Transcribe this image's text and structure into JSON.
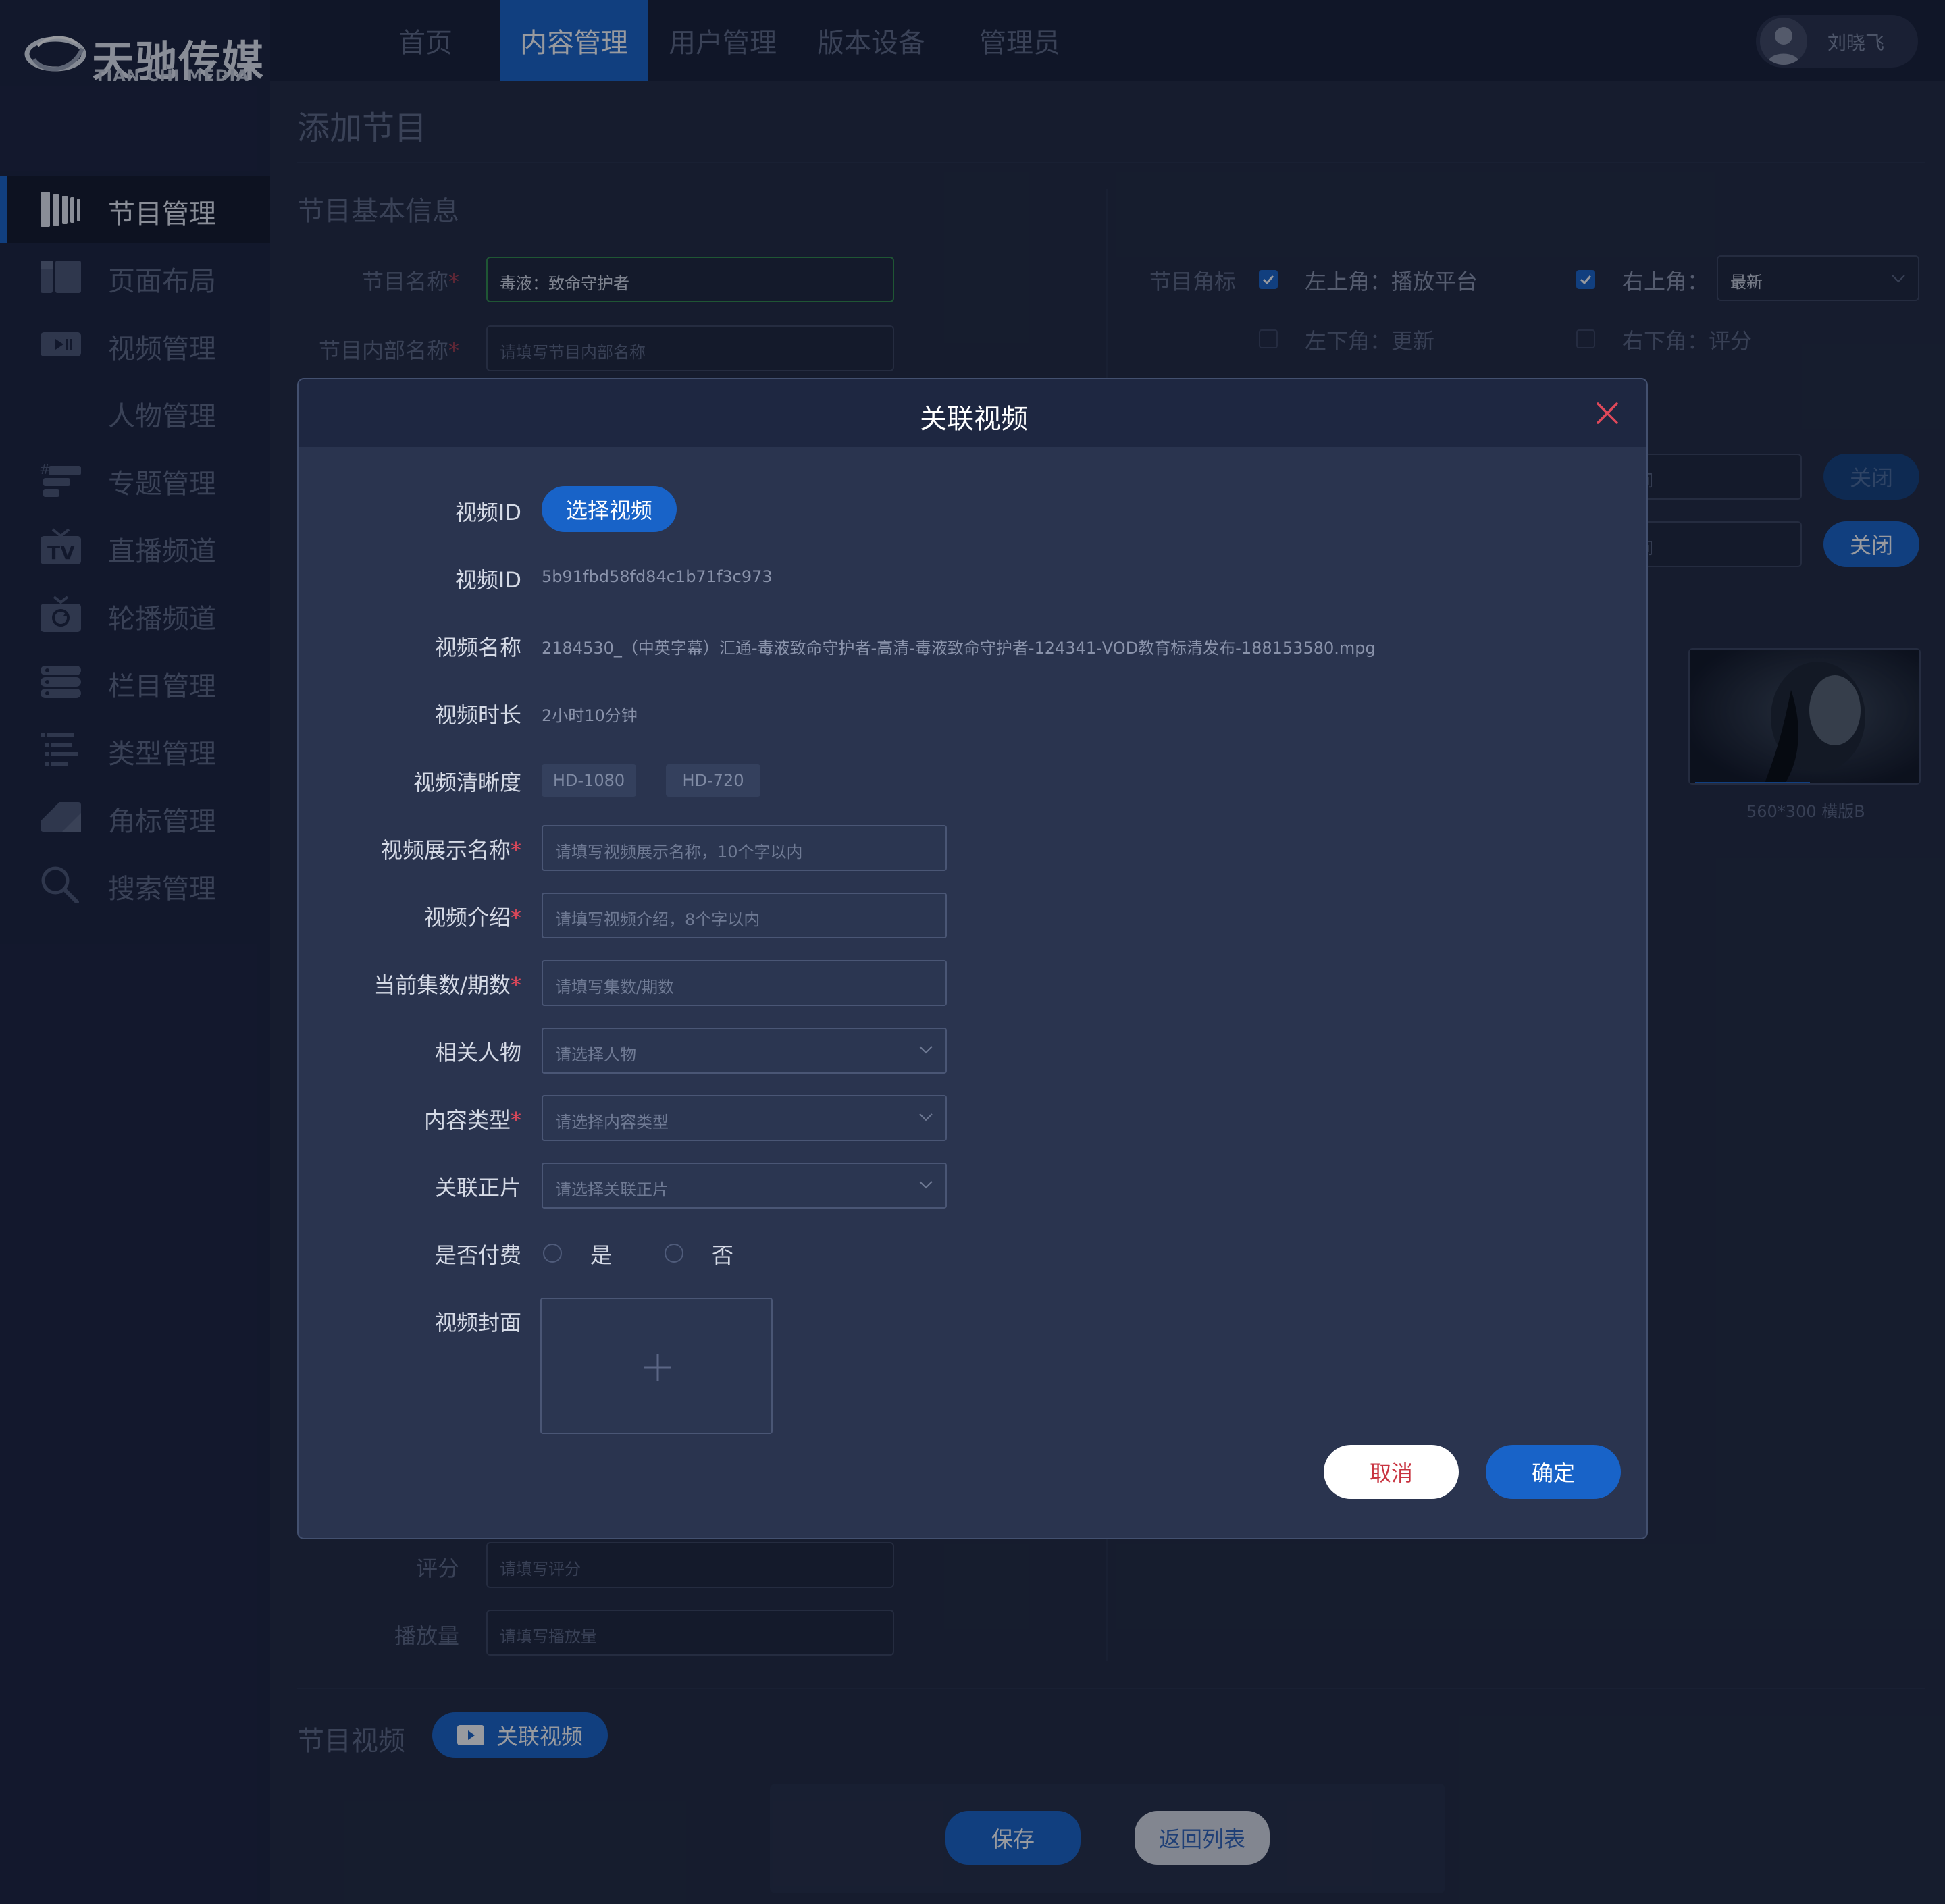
{
  "brand": {
    "name_cn": "天驰传媒",
    "name_en": "TIAN CHI MEDIA"
  },
  "nav": {
    "tabs": [
      {
        "label": "首页",
        "active": false
      },
      {
        "label": "内容管理",
        "active": true
      },
      {
        "label": "用户管理",
        "active": false
      },
      {
        "label": "版本设备",
        "active": false
      },
      {
        "label": "管理员",
        "active": false
      }
    ]
  },
  "user": {
    "name": "刘晓飞",
    "icon": "user-avatar-icon"
  },
  "sidebar": {
    "items": [
      {
        "label": "节目管理",
        "icon": "program-icon",
        "active": true
      },
      {
        "label": "页面布局",
        "icon": "layout-icon",
        "active": false
      },
      {
        "label": "视频管理",
        "icon": "video-icon",
        "active": false
      },
      {
        "label": "人物管理",
        "icon": "",
        "active": false
      },
      {
        "label": "专题管理",
        "icon": "topic-icon",
        "active": false
      },
      {
        "label": "直播频道",
        "icon": "tv-icon",
        "active": false
      },
      {
        "label": "轮播频道",
        "icon": "carousel-icon",
        "active": false
      },
      {
        "label": "栏目管理",
        "icon": "column-icon",
        "active": false
      },
      {
        "label": "类型管理",
        "icon": "type-icon",
        "active": false
      },
      {
        "label": "角标管理",
        "icon": "corner-mark-icon",
        "active": false
      },
      {
        "label": "搜索管理",
        "icon": "search-icon",
        "active": false
      }
    ]
  },
  "page": {
    "title": "添加节目",
    "basic_info": {
      "title": "节目基本信息",
      "name_label": "节目名称",
      "name_value": "毒液：致命守护者",
      "internal_name_label": "节目内部名称",
      "internal_name_placeholder": "请填写节目内部名称",
      "score_label": "评分",
      "score_placeholder": "请填写评分",
      "plays_label": "播放量",
      "plays_placeholder": "请填写播放量"
    },
    "corner_marks": {
      "label": "节目角标",
      "top_left": {
        "label": "左上角：播放平台",
        "checked": true
      },
      "top_right": {
        "label": "右上角：",
        "checked": true,
        "value": "最新"
      },
      "bottom_left": {
        "label": "左下角：更新",
        "checked": false
      },
      "bottom_right": {
        "label": "右下角：评分",
        "checked": false
      }
    },
    "right_rows": [
      {
        "select_text": "时间",
        "button_label": "关闭",
        "button_enabled": false
      },
      {
        "select_text": "时间",
        "button_label": "关闭",
        "button_enabled": true
      }
    ],
    "thumbnail": {
      "label": "560*300 横版B"
    },
    "video_section": {
      "title": "节目视频",
      "button_label": "关联视频",
      "button_icon": "play-icon"
    },
    "footer": {
      "save_label": "保存",
      "back_label": "返回列表"
    }
  },
  "modal": {
    "title": "关联视频",
    "close_icon": "close-icon",
    "select_video": {
      "label": "视频ID",
      "button_label": "选择视频"
    },
    "video_id": {
      "label": "视频ID",
      "value": "5b91fbd58fd84c1b71f3c973"
    },
    "video_name": {
      "label": "视频名称",
      "value": "2184530_（中英字幕）汇通-毒液致命守护者-高清-毒液致命守护者-124341-VOD教育标清发布-188153580.mpg"
    },
    "duration": {
      "label": "视频时长",
      "value": "2小时10分钟"
    },
    "resolution": {
      "label": "视频清晰度",
      "values": [
        "HD-1080",
        "HD-720"
      ]
    },
    "display_name": {
      "label": "视频展示名称",
      "placeholder": "请填写视频展示名称，10个字以内"
    },
    "intro": {
      "label": "视频介绍",
      "placeholder": "请填写视频介绍，8个字以内"
    },
    "episode": {
      "label": "当前集数/期数",
      "placeholder": "请填写集数/期数"
    },
    "people": {
      "label": "相关人物",
      "placeholder": "请选择人物"
    },
    "content_type": {
      "label": "内容类型",
      "placeholder": "请选择内容类型"
    },
    "related": {
      "label": "关联正片",
      "placeholder": "请选择关联正片"
    },
    "paid": {
      "label": "是否付费",
      "options": [
        "是",
        "否"
      ]
    },
    "cover": {
      "label": "视频封面",
      "icon": "plus-icon"
    },
    "cancel_label": "取消",
    "confirm_label": "确定"
  },
  "colors": {
    "accent": "#1863c8",
    "sidebar_bg": "#19203a",
    "page_bg": "#1f273d",
    "required": "#e0485a",
    "cancel_text": "#c8333f"
  }
}
